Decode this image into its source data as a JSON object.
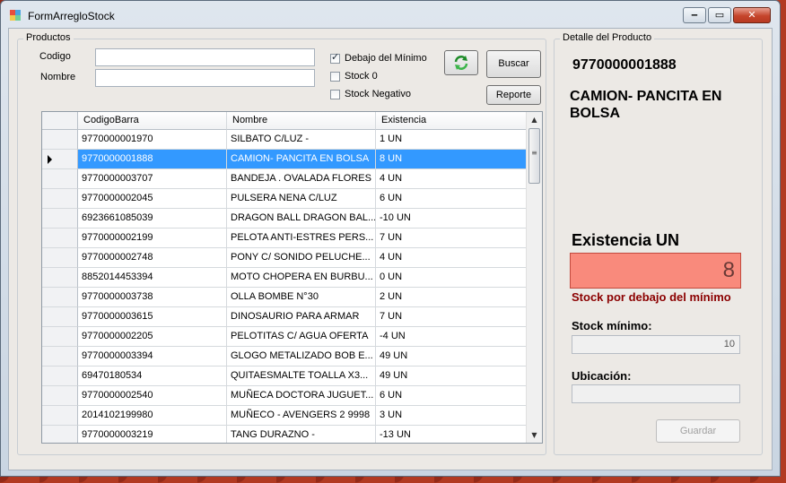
{
  "window": {
    "title": "FormArregloStock"
  },
  "productos": {
    "group_title": "Productos",
    "codigo_label": "Codigo",
    "codigo_value": "",
    "nombre_label": "Nombre",
    "nombre_value": "",
    "chk_debajo_label": "Debajo del Mínimo",
    "chk_debajo_checked": true,
    "chk_stock0_label": "Stock 0",
    "chk_stock0_checked": false,
    "chk_negativo_label": "Stock Negativo",
    "chk_negativo_checked": false,
    "buscar_label": "Buscar",
    "reporte_label": "Reporte"
  },
  "grid": {
    "columns": [
      "CodigoBarra",
      "Nombre",
      "Existencia"
    ],
    "selected_index": 1,
    "rows": [
      [
        "9770000001970",
        "SILBATO C/LUZ -",
        "1 UN"
      ],
      [
        "9770000001888",
        "CAMION- PANCITA EN BOLSA",
        "8 UN"
      ],
      [
        "9770000003707",
        "BANDEJA . OVALADA FLORES",
        "4 UN"
      ],
      [
        "9770000002045",
        "PULSERA NENA C/LUZ",
        "6 UN"
      ],
      [
        "6923661085039",
        "DRAGON BALL DRAGON BAL...",
        "-10 UN"
      ],
      [
        "9770000002199",
        "PELOTA ANTI-ESTRES PERS...",
        "7 UN"
      ],
      [
        "9770000002748",
        "PONY  C/ SONIDO PELUCHE...",
        "4 UN"
      ],
      [
        "8852014453394",
        "MOTO CHOPERA EN BURBU...",
        "0 UN"
      ],
      [
        "9770000003738",
        "OLLA  BOMBE  N°30",
        "2 UN"
      ],
      [
        "9770000003615",
        "DINOSAURIO PARA ARMAR",
        "7 UN"
      ],
      [
        "9770000002205",
        "PELOTITAS C/ AGUA OFERTA",
        "-4 UN"
      ],
      [
        "9770000003394",
        "GLOGO  METALIZADO BOB E...",
        "49 UN"
      ],
      [
        "69470180534",
        "QUITAESMALTE TOALLA  X3...",
        "49 UN"
      ],
      [
        "9770000002540",
        "MUÑECA DOCTORA JUGUET...",
        "6 UN"
      ],
      [
        "2014102199980",
        "MUÑECO - AVENGERS 2 9998",
        "3 UN"
      ],
      [
        "9770000003219",
        "TANG DURAZNO -",
        "-13 UN"
      ]
    ]
  },
  "detalle": {
    "group_title": "Detalle del Producto",
    "codigo": "9770000001888",
    "nombre": "CAMION- PANCITA EN BOLSA",
    "existencia_title": "Existencia UN",
    "existencia_value": "8",
    "warning": "Stock por debajo del mínimo",
    "stock_minimo_label": "Stock mínimo:",
    "stock_minimo_value": "10",
    "ubicacion_label": "Ubicación:",
    "ubicacion_value": "",
    "guardar_label": "Guardar"
  },
  "colors": {
    "selection": "#3399ff",
    "existencia_bg": "#f98a7c",
    "warning": "#8b0000"
  }
}
